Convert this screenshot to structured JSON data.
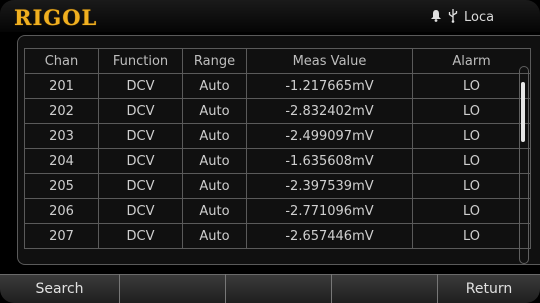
{
  "header": {
    "brand": "RIGOL",
    "bell_icon": "bell-icon",
    "usb_icon": "usb-icon",
    "mode_text": "Loca"
  },
  "table": {
    "columns": [
      "Chan",
      "Function",
      "Range",
      "Meas Value",
      "Alarm"
    ],
    "rows": [
      {
        "chan": "201",
        "function": "DCV",
        "range": "Auto",
        "value": "-1.217665mV",
        "alarm": "LO"
      },
      {
        "chan": "202",
        "function": "DCV",
        "range": "Auto",
        "value": "-2.832402mV",
        "alarm": "LO"
      },
      {
        "chan": "203",
        "function": "DCV",
        "range": "Auto",
        "value": "-2.499097mV",
        "alarm": "LO"
      },
      {
        "chan": "204",
        "function": "DCV",
        "range": "Auto",
        "value": "-1.635608mV",
        "alarm": "LO"
      },
      {
        "chan": "205",
        "function": "DCV",
        "range": "Auto",
        "value": "-2.397539mV",
        "alarm": "LO"
      },
      {
        "chan": "206",
        "function": "DCV",
        "range": "Auto",
        "value": "-2.771096mV",
        "alarm": "LO"
      },
      {
        "chan": "207",
        "function": "DCV",
        "range": "Auto",
        "value": "-2.657446mV",
        "alarm": "LO"
      }
    ]
  },
  "softkeys": [
    "Search",
    "",
    "",
    "",
    "Return"
  ]
}
